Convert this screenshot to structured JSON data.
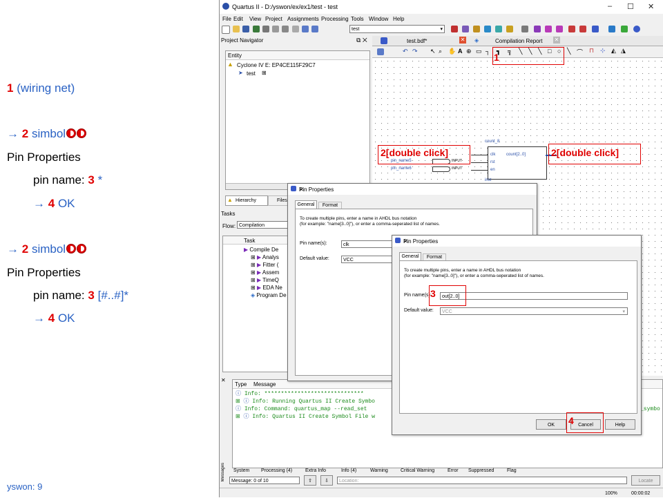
{
  "notes": {
    "line1_num": "1",
    "line1_text": "(wiring net)",
    "arrow": "→",
    "s1_num": "2",
    "s1_text": "simbol",
    "s1_props": "Pin Properties",
    "s1_pin_label": "pin name:",
    "s1_pin_num": "3",
    "s1_pin_value": "*",
    "s1_ok_num": "4",
    "s1_ok_text": "OK",
    "s2_num": "2",
    "s2_text": "simbol",
    "s2_props": "Pin Properties",
    "s2_pin_label": "pin name:",
    "s2_pin_num": "3",
    "s2_pin_value": "[#..#]*",
    "s2_ok_num": "4",
    "s2_ok_text": "OK",
    "footer": "yswon:   9"
  },
  "app": {
    "title": "Quartus II - D:/yswon/ex/ex1/test - test",
    "menu": [
      "File",
      "Edit",
      "View",
      "Project",
      "Assignments",
      "Processing",
      "Tools",
      "Window",
      "Help"
    ],
    "toolbar_dropdown": "test",
    "nav_title": "Project Navigator",
    "entity_header": "Entity",
    "device": "Cyclone IV E: EP4CE115F29C7",
    "top_entity": "test",
    "nav_tab_hierarchy": "Hierarchy",
    "nav_tab_files": "Files",
    "tasks_title": "Tasks",
    "flow_label": "Flow:",
    "flow_value": "Compilation",
    "task_col": "Task",
    "tasks": [
      "Compile De",
      "Analys",
      "Fitter (",
      "Assem",
      "TimeQ",
      "EDA Ne",
      "Program De"
    ],
    "doc_tab_bdf": "test.bdf*",
    "doc_tab_report": "Compilation Report",
    "block_name": "count_8",
    "block_ports_in": [
      "clk",
      "rst",
      "en"
    ],
    "block_port_out": "count[2..0]",
    "block_inst": "inst",
    "pin_names": [
      "pin_name5",
      "pin_name6"
    ],
    "pin_kind": "INPUT",
    "msg_cols": [
      "Type",
      "Message"
    ],
    "messages": [
      "Info: ******************************",
      "Info: Running Quartus II Create Symbo",
      "Info: Command: quartus_map --read_set",
      "Info: Quartus II Create Symbol File w"
    ],
    "msg_overflow": "_symbo",
    "msg_tabs": [
      "System",
      "Processing (4)",
      "Extra Info",
      "Info (4)",
      "Warning",
      "Critical Warning",
      "Error",
      "Suppressed",
      "Flag"
    ],
    "messages_side": "Messages",
    "msg_count": "Message: 0 of 10",
    "location_label": "Location:",
    "locate_btn": "Locate",
    "zoom": "100%",
    "time": "00:00:02"
  },
  "dialog1": {
    "title": "Pin Properties",
    "tab_general": "General",
    "tab_format": "Format",
    "help1": "To create multiple pins, enter a name in AHDL bus notation",
    "help2": "(for example: \"name[3..0]\"), or enter a comma-seperated list of names.",
    "pin_label": "Pin name(s):",
    "pin_value": "clk",
    "default_label": "Default value:",
    "default_value": "VCC"
  },
  "dialog2": {
    "title": "Pin Properties",
    "tab_general": "General",
    "tab_format": "Format",
    "help1": "To create multiple pins, enter a name in AHDL bus notation",
    "help2": "(for example: \"name[3..0]\"), or enter a comma-seperated list of names.",
    "pin_label": "Pin name(s):",
    "pin_value": "out[2..0]",
    "default_label": "Default value:",
    "default_value": "VCC",
    "ok": "OK",
    "cancel": "Cancel",
    "help": "Help"
  },
  "annotations": {
    "a1": "1",
    "a2_left": "2[double click]",
    "a2_right": "2[double click]",
    "a3": "3",
    "a4": "4"
  }
}
